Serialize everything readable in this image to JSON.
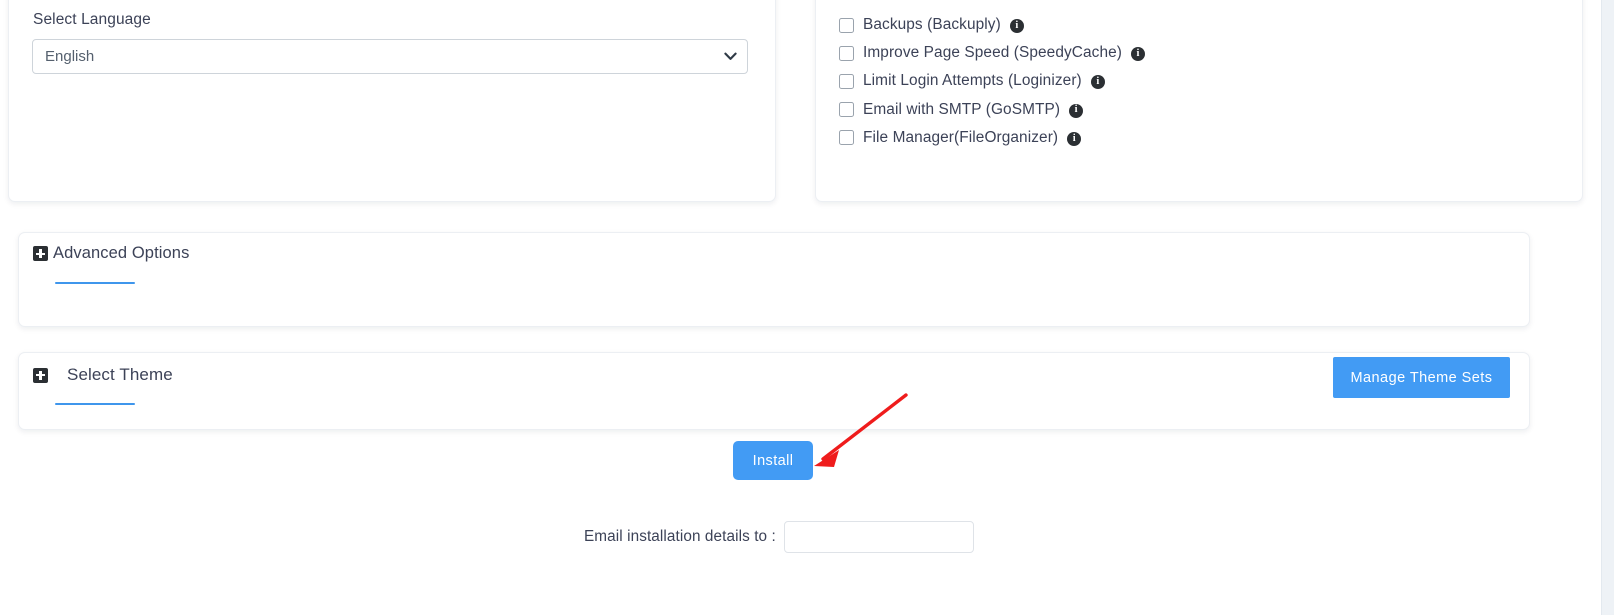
{
  "language_panel": {
    "label": "Select Language",
    "selected": "English",
    "options": [
      "English"
    ],
    "caret_icon": "chevron-down-icon"
  },
  "features_panel": {
    "items": [
      {
        "label": "Backups (Backuply)",
        "checked": false,
        "info_icon": "info-icon"
      },
      {
        "label": "Improve Page Speed (SpeedyCache)",
        "checked": false,
        "info_icon": "info-icon"
      },
      {
        "label": "Limit Login Attempts (Loginizer)",
        "checked": false,
        "info_icon": "info-icon"
      },
      {
        "label": "Email with SMTP (GoSMTP)",
        "checked": false,
        "info_icon": "info-icon"
      },
      {
        "label": "File Manager(FileOrganizer)",
        "checked": false,
        "info_icon": "info-icon"
      }
    ],
    "info_glyph": "i"
  },
  "advanced_section": {
    "title": "Advanced Options",
    "expand_icon": "plus-square-icon"
  },
  "theme_section": {
    "title": "Select Theme",
    "expand_icon": "plus-square-icon",
    "manage_button": "Manage Theme Sets"
  },
  "install": {
    "button_label": "Install",
    "annotation_icon": "red-arrow-annotation"
  },
  "email_row": {
    "label": "Email installation details to :",
    "value": "",
    "placeholder": ""
  },
  "colors": {
    "accent_blue": "#429bf4",
    "underline_blue": "#3f96ec",
    "text": "#3c4257",
    "icon_dark": "#2b2f33",
    "annotation_red": "#ef1c1c",
    "card_border": "#eceff3",
    "gutter": "#eef2f6"
  }
}
